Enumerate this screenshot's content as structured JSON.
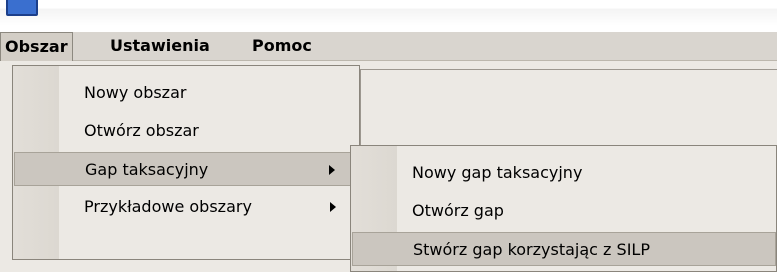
{
  "title": "",
  "menubar": {
    "items": [
      {
        "label": "Obszar"
      },
      {
        "label": "Ustawienia"
      },
      {
        "label": "Pomoc"
      }
    ]
  },
  "menu_obszar": {
    "items": [
      {
        "label": "Nowy obszar"
      },
      {
        "label": "Otwórz obszar"
      },
      {
        "label": "Gap taksacyjny"
      },
      {
        "label": "Przykładowe obszary"
      }
    ]
  },
  "submenu_gap": {
    "items": [
      {
        "label": "Nowy gap taksacyjny"
      },
      {
        "label": "Otwórz gap"
      },
      {
        "label": "Stwórz gap korzystając z SILP"
      }
    ]
  },
  "icons": {
    "submenu_arrow": "chevron-right-icon",
    "app_icon": "app-icon"
  }
}
